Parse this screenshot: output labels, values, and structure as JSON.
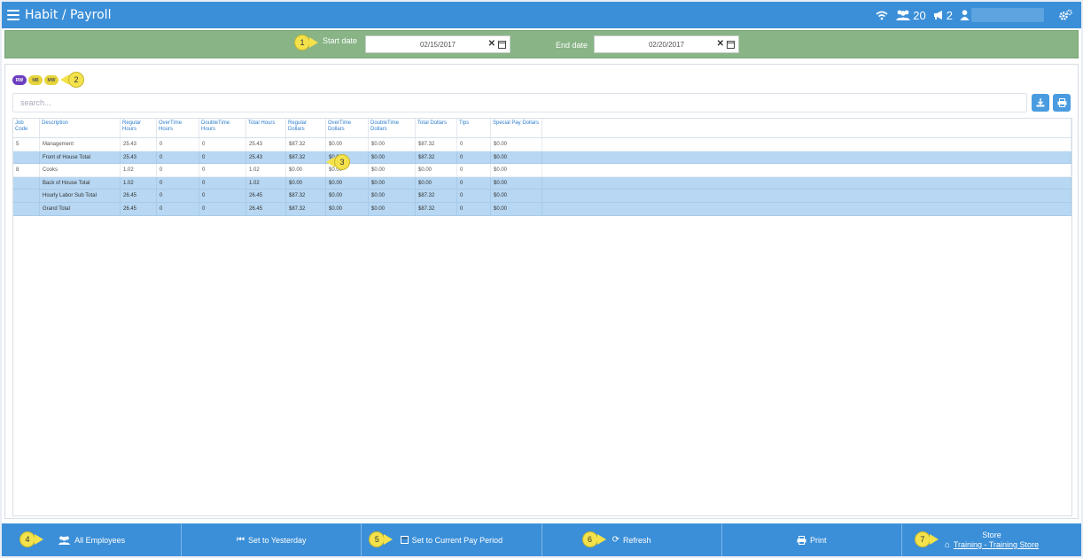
{
  "header": {
    "title": "Habit / Payroll",
    "staff_count": "20",
    "alert_count": "2"
  },
  "dates": {
    "start_label": "Start date",
    "start_value": "02/15/2017",
    "end_label": "End date",
    "end_value": "02/20/2017"
  },
  "filters": {
    "pills": [
      "RW",
      "NB",
      "MW"
    ]
  },
  "search": {
    "placeholder": "search..."
  },
  "table": {
    "headers": [
      "Job Code",
      "Description",
      "Regular Hours",
      "OverTime Hours",
      "DoubleTime Hours",
      "Total Hours",
      "Regular Dollars",
      "OverTime Dollars",
      "DoubleTime Dollars",
      "Total Dollars",
      "Tips",
      "Special Pay Dollars"
    ],
    "rows": [
      [
        "5",
        "Management",
        "25.43",
        "0",
        "0",
        "25.43",
        "$87.32",
        "$0.00",
        "$0.00",
        "$87.32",
        "0",
        "$0.00"
      ],
      [
        "",
        "Front of House Total",
        "25.43",
        "0",
        "0",
        "25.43",
        "$87.32",
        "$0.00",
        "$0.00",
        "$87.32",
        "0",
        "$0.00"
      ],
      [
        "8",
        "Cooks",
        "1.02",
        "0",
        "0",
        "1.02",
        "$0.00",
        "$0.00",
        "$0.00",
        "$0.00",
        "0",
        "$0.00"
      ],
      [
        "",
        "Back of House Total",
        "1.02",
        "0",
        "0",
        "1.02",
        "$0.00",
        "$0.00",
        "$0.00",
        "$0.00",
        "0",
        "$0.00"
      ],
      [
        "",
        "Hourly Labor Sub Total",
        "26.45",
        "0",
        "0",
        "26.45",
        "$87.32",
        "$0.00",
        "$0.00",
        "$87.32",
        "0",
        "$0.00"
      ],
      [
        "",
        "Grand Total",
        "26.45",
        "0",
        "0",
        "26.45",
        "$87.32",
        "$0.00",
        "$0.00",
        "$87.32",
        "0",
        "$0.00"
      ]
    ]
  },
  "callouts": [
    "1",
    "2",
    "3",
    "4",
    "5",
    "6",
    "7"
  ],
  "footer": {
    "all_employees": "All Employees",
    "set_yesterday": "Set to Yesterday",
    "set_pay_period": "Set to Current Pay Period",
    "refresh": "Refresh",
    "print": "Print",
    "store_label": "Store",
    "store_name": "Training - Training Store"
  },
  "colors": {
    "primary": "#3b8fd8",
    "date_bar": "#88b486",
    "row_highlight": "#b7d7f2",
    "callout": "#f3e24b",
    "pill_rw": "#6b3fbf",
    "pill_other": "#e6d43a"
  }
}
